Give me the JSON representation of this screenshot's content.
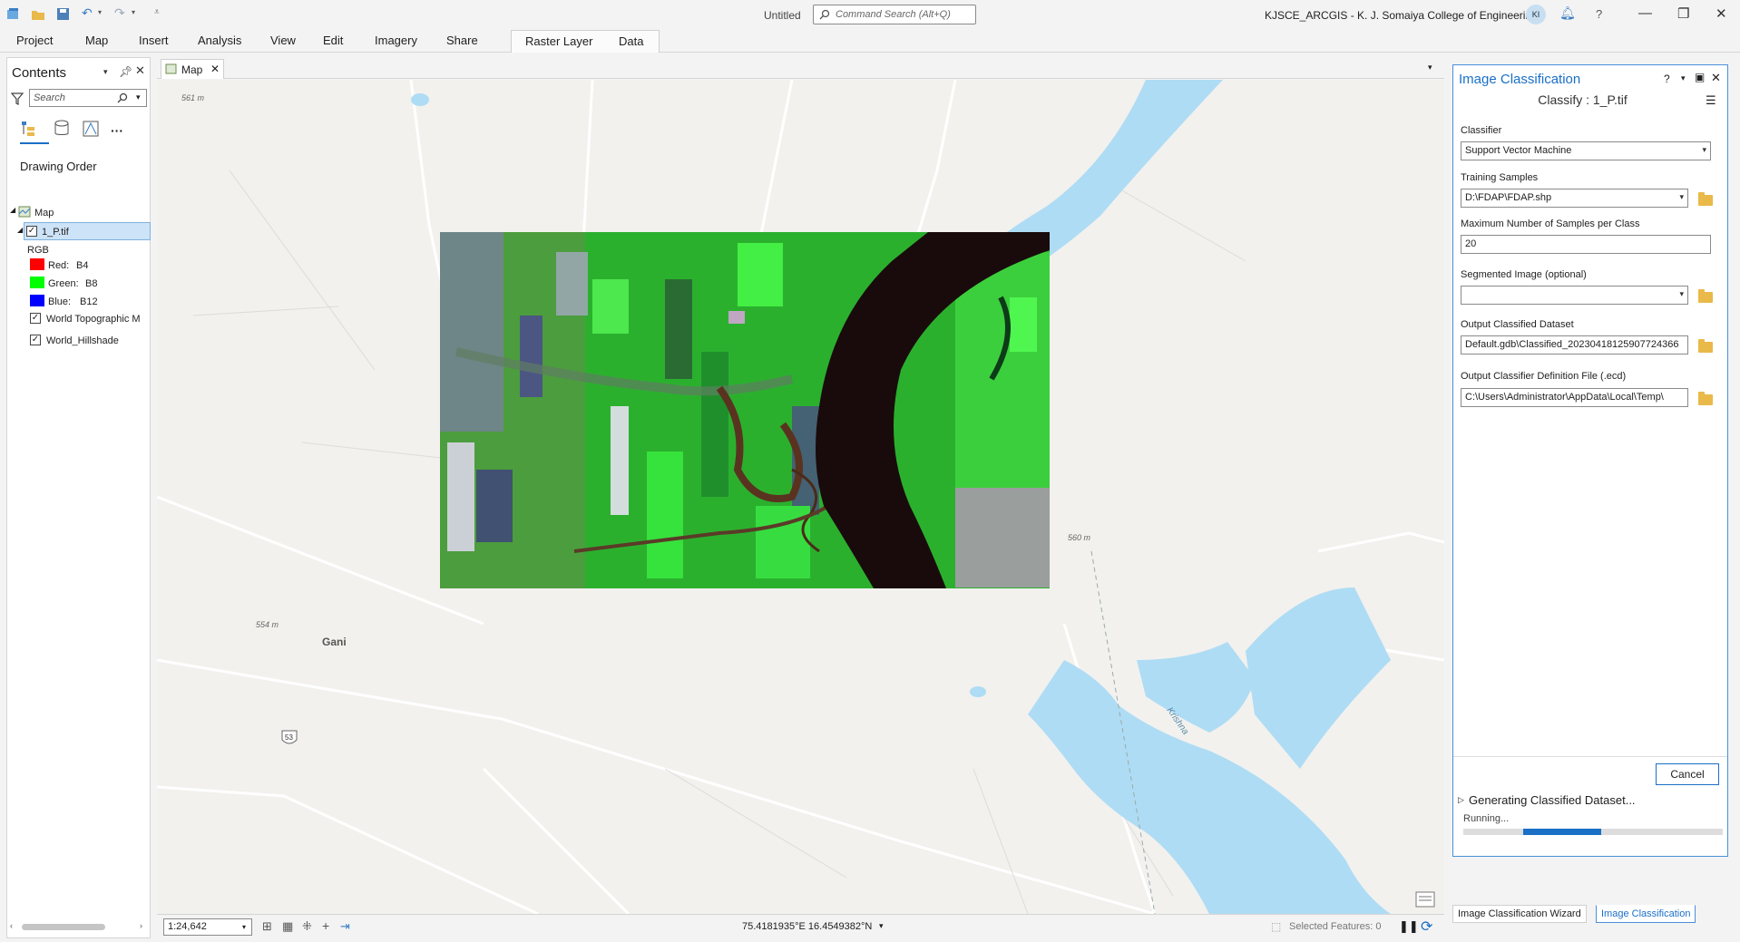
{
  "titlebar": {
    "document_title": "Untitled",
    "command_search_placeholder": "Command Search (Alt+Q)",
    "org": "KJSCE_ARCGIS - K. J. Somaiya College of Engineering",
    "avatar_initials": "KI"
  },
  "ribbon": {
    "tabs": [
      "Project",
      "Map",
      "Insert",
      "Analysis",
      "View",
      "Edit",
      "Imagery",
      "Share"
    ],
    "context_tabs": [
      "Raster Layer",
      "Data"
    ]
  },
  "contents": {
    "title": "Contents",
    "search_placeholder": "Search",
    "drawing_order": "Drawing Order",
    "map_label": "Map",
    "layer_name": "1_P.tif",
    "renderer": "RGB",
    "bands": [
      {
        "label": "Red:",
        "band": "B4",
        "color": "#ff0000"
      },
      {
        "label": "Green:",
        "band": "B8",
        "color": "#00ff00"
      },
      {
        "label": "Blue:",
        "band": "B12",
        "color": "#0000ff"
      }
    ],
    "basemaps": [
      "World Topographic M",
      "World_Hillshade"
    ]
  },
  "map": {
    "tab_label": "Map",
    "elevation_labels": [
      "561 m",
      "560 m",
      "554 m"
    ],
    "place_label": "Gani",
    "river_label": "Krishna",
    "road_shield": "53"
  },
  "statusbar": {
    "scale": "1:24,642",
    "coordinates": "75.4181935°E 16.4549382°N",
    "selected_features": "Selected Features: 0"
  },
  "gp_pane": {
    "title": "Image Classification",
    "subtitle": "Classify : 1_P.tif",
    "fields": [
      {
        "label": "Classifier",
        "value": "Support Vector Machine"
      },
      {
        "label": "Training Samples",
        "value": "D:\\FDAP\\FDAP.shp"
      },
      {
        "label": "Maximum Number of Samples per Class",
        "value": "20"
      },
      {
        "label": "Segmented Image (optional)",
        "value": ""
      },
      {
        "label": "Output Classified Dataset",
        "value": "Default.gdb\\Classified_20230418125907724366"
      },
      {
        "label": "Output Classifier Definition File (.ecd)",
        "value": "C:\\Users\\Administrator\\AppData\\Local\\Temp\\"
      }
    ],
    "cancel_label": "Cancel",
    "job_title": "Generating Classified Dataset...",
    "job_status": "Running...",
    "progress_fraction": 0.3,
    "bottom_tabs": [
      "Image Classification Wizard",
      "Image Classification"
    ]
  }
}
